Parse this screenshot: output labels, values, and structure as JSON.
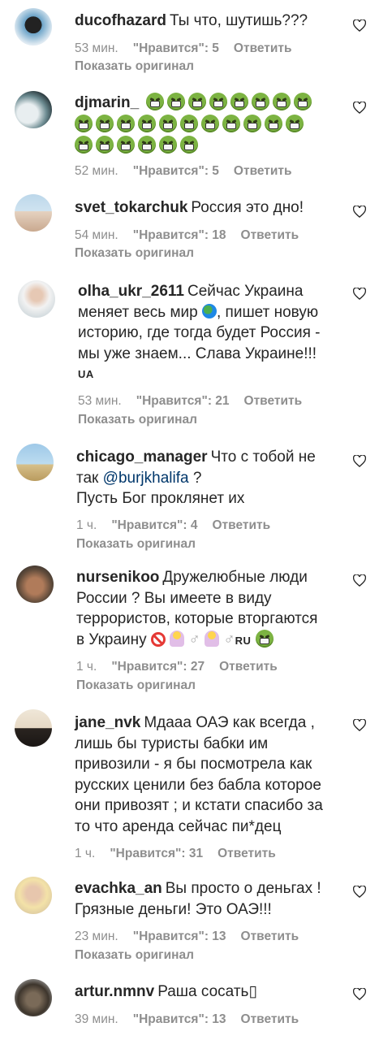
{
  "comments": [
    {
      "username": "ducofhazard",
      "text": "Ты что, шутишь???",
      "time": "53 мин.",
      "likes": "\"Нравится\": 5",
      "reply": "Ответить",
      "show_original": "Показать оригинал"
    },
    {
      "username": "djmarin_",
      "text": "",
      "time": "52 мин.",
      "likes": "\"Нравится\": 5",
      "reply": "Ответить"
    },
    {
      "username": "svet_tokarchuk",
      "text": "Россия это дно!",
      "time": "54 мин.",
      "likes": "\"Нравится\": 18",
      "reply": "Ответить",
      "show_original": "Показать оригинал"
    },
    {
      "username": "olha_ukr_2611",
      "text_1": "Сейчас Украина",
      "text_2": "меняет весь мир",
      "text_2b": ", пишет новую",
      "text_3": "историю, где тогда будет Россия -",
      "text_4": "мы уже знаем... Слава Украине!!!",
      "flag": "UA",
      "time": "53 мин.",
      "likes": "\"Нравится\": 21",
      "reply": "Ответить",
      "show_original": "Показать оригинал"
    },
    {
      "username": "chicago_manager",
      "text_1": "Что с тобой не",
      "text_2a": "так ",
      "mention": "@burjkhalifa",
      "text_2b": " ?",
      "text_3": "Пусть Бог проклянет их",
      "time": "1 ч.",
      "likes": "\"Нравится\": 4",
      "reply": "Ответить",
      "show_original": "Показать оригинал"
    },
    {
      "username": "nursenikoo",
      "text_1": "Дружелюбные люди",
      "text_2": "России ? Вы имеете в виду",
      "text_3": "террористов, которые вторгаются",
      "text_4": "в Украину",
      "sym_1": "♂",
      "sym_2": "♂",
      "flag": "RU",
      "time": "1 ч.",
      "likes": "\"Нравится\": 27",
      "reply": "Ответить",
      "show_original": "Показать оригинал"
    },
    {
      "username": "jane_nvk",
      "text_1": "Мдааа ОАЭ как всегда ,",
      "text_2": "лишь бы туристы бабки им",
      "text_3": "привозили - я бы посмотрела как",
      "text_4": "русских ценили без бабла которое",
      "text_5": "они привозят ; и кстати спасибо за",
      "text_6": "то что аренда сейчас пи*дец",
      "time": "1 ч.",
      "likes": "\"Нравится\": 31",
      "reply": "Ответить"
    },
    {
      "username": "evachka_an",
      "text_1": "Вы просто о деньгах !",
      "text_2": "Грязные деньги! Это ОАЭ!!!",
      "time": "23 мин.",
      "likes": "\"Нравится\": 13",
      "reply": "Ответить",
      "show_original": "Показать оригинал"
    },
    {
      "username": "artur.nmnv",
      "text": "Раша сосать▯",
      "time": "39 мин.",
      "likes": "\"Нравится\": 13",
      "reply": "Ответить"
    }
  ]
}
